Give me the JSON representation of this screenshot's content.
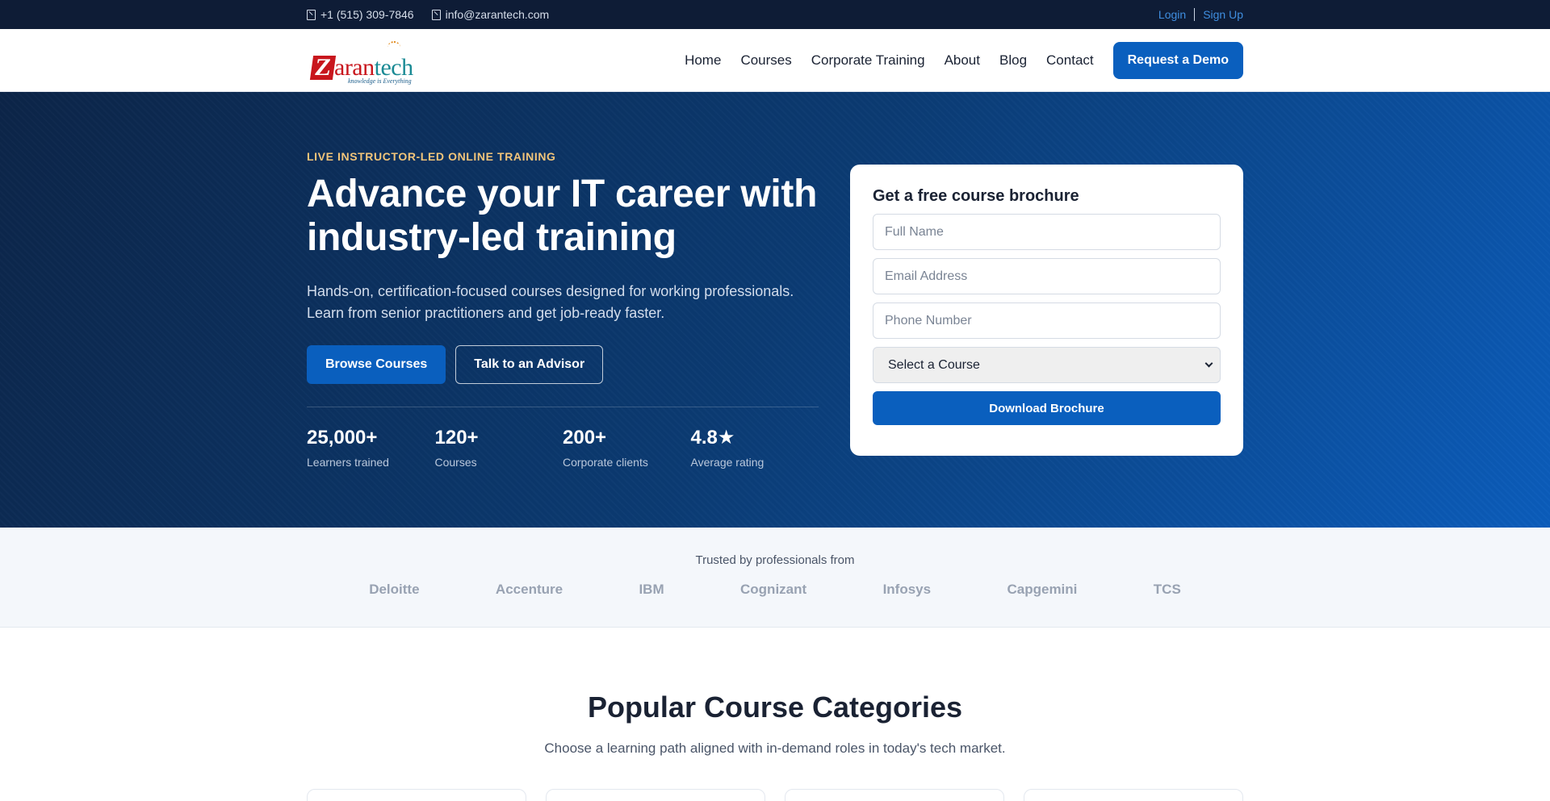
{
  "topbar": {
    "phone": "+1 (515) 309-7846",
    "email": "info@zarantech.com",
    "login": "Login",
    "signup": "Sign Up"
  },
  "header": {
    "logo": {
      "z": "Z",
      "text_red": "aran",
      "text_teal": "tech",
      "tagline": "knowledge is Everything"
    },
    "nav": [
      {
        "label": "Home"
      },
      {
        "label": "Courses"
      },
      {
        "label": "Corporate Training"
      },
      {
        "label": "About"
      },
      {
        "label": "Blog"
      },
      {
        "label": "Contact"
      }
    ],
    "cta": "Request a Demo"
  },
  "hero": {
    "eyebrow": "LIVE INSTRUCTOR-LED ONLINE TRAINING",
    "title": "Advance your IT career with industry-led training",
    "subtitle": "Hands-on, certification-focused courses designed for working professionals. Learn from senior practitioners and get job-ready faster.",
    "primary_button": "Browse Courses",
    "secondary_button": "Talk to an Advisor",
    "stats": [
      {
        "value": "25,000+",
        "label": "Learners trained"
      },
      {
        "value": "120+",
        "label": "Courses"
      },
      {
        "value": "200+",
        "label": "Corporate clients"
      },
      {
        "value": "4.8★",
        "label": "Average rating"
      }
    ]
  },
  "form": {
    "title": "Get a free course brochure",
    "full_name_placeholder": "Full Name",
    "email_placeholder": "Email Address",
    "phone_placeholder": "Phone Number",
    "course_select": "Select a Course",
    "submit": "Download Brochure"
  },
  "trusted": {
    "title": "Trusted by professionals from",
    "companies": [
      "Deloitte",
      "Accenture",
      "IBM",
      "Cognizant",
      "Infosys",
      "Capgemini",
      "TCS"
    ]
  },
  "categories": {
    "title": "Popular Course Categories",
    "subtitle": "Choose a learning path aligned with in-demand roles in today's tech market."
  },
  "colors": {
    "topbar": "#0e1c36",
    "primary": "#0a5fbe",
    "eyebrow": "#f2c57a",
    "logo_red": "#c8161d",
    "logo_teal": "#1a8a94"
  }
}
